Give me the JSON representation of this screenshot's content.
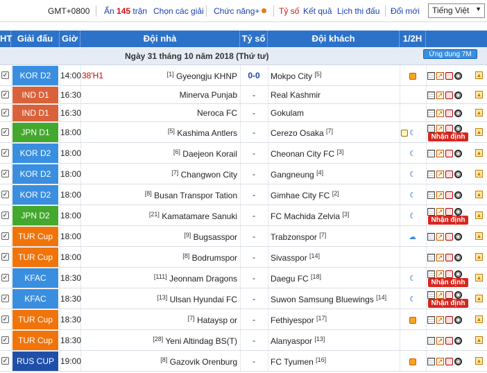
{
  "topbar": {
    "timezone": "GMT+0800",
    "hide_prefix": "Ẩn",
    "hide_count": "145",
    "hide_suffix": "trận",
    "choose_league": "Chọn các giải",
    "functions": "Chức năng+",
    "score": "Tỷ số",
    "results": "Kết quả",
    "schedule": "Lịch thi đấu",
    "refresh": "Đổi mới",
    "language": "Tiếng Việt"
  },
  "header": {
    "ht": "HT",
    "league": "Giải đấu",
    "time": "Giờ",
    "home": "Đội nhà",
    "score": "Tỷ số",
    "away": "Đội khách",
    "half": "1/2H"
  },
  "date_label": "Ngày 31 tháng 10 năm 2018 (Thứ tư)",
  "app_button": "Ứng dụng 7M",
  "analysis_label": "Nhận định",
  "colors": {
    "kor": "#3a8ee0",
    "ind": "#d9623a",
    "jpn": "#43a82e",
    "tur": "#f0740a",
    "kfac": "#3a8ee0",
    "rus": "#1f4fa8"
  },
  "matches": [
    {
      "league": "KOR D2",
      "color": "kor",
      "time": "14:00",
      "minute": "38'H1",
      "home_rank": "[1]",
      "home": "Gyeongju KHNP",
      "score": "0-0",
      "away": "Mokpo City",
      "away_rank": "[5]",
      "half": "ball",
      "analysis": false
    },
    {
      "league": "IND D1",
      "color": "ind",
      "time": "16:30",
      "minute": "",
      "home_rank": "",
      "home": "Minerva Punjab",
      "score": "-",
      "away": "Real Kashmir",
      "away_rank": "",
      "half": "",
      "analysis": false
    },
    {
      "league": "IND D1",
      "color": "ind",
      "time": "16:30",
      "minute": "",
      "home_rank": "",
      "home": "Neroca FC",
      "score": "-",
      "away": "Gokulam",
      "away_rank": "",
      "half": "",
      "analysis": false
    },
    {
      "league": "JPN D1",
      "color": "jpn",
      "time": "18:00",
      "minute": "",
      "home_rank": "[5]",
      "home": "Kashima Antlers",
      "score": "-",
      "away": "Cerezo Osaka",
      "away_rank": "[7]",
      "half": "tv-moon",
      "analysis": true
    },
    {
      "league": "KOR D2",
      "color": "kor",
      "time": "18:00",
      "minute": "",
      "home_rank": "[6]",
      "home": "Daejeon Korail",
      "score": "-",
      "away": "Cheonan City FC",
      "away_rank": "[3]",
      "half": "moon",
      "analysis": false
    },
    {
      "league": "KOR D2",
      "color": "kor",
      "time": "18:00",
      "minute": "",
      "home_rank": "[7]",
      "home": "Changwon City",
      "score": "-",
      "away": "Gangneung",
      "away_rank": "[4]",
      "half": "moon",
      "analysis": false
    },
    {
      "league": "KOR D2",
      "color": "kor",
      "time": "18:00",
      "minute": "",
      "home_rank": "[8]",
      "home": "Busan Transpor Tation",
      "score": "-",
      "away": "Gimhae City FC",
      "away_rank": "[2]",
      "half": "moon",
      "analysis": false
    },
    {
      "league": "JPN D2",
      "color": "jpn",
      "time": "18:00",
      "minute": "",
      "home_rank": "[21]",
      "home": "Kamatamare Sanuki",
      "score": "-",
      "away": "FC Machida Zelvia",
      "away_rank": "[3]",
      "half": "moon",
      "analysis": true
    },
    {
      "league": "TUR Cup",
      "color": "tur",
      "time": "18:00",
      "minute": "",
      "home_rank": "[9]",
      "home": "Bugsasspor",
      "score": "-",
      "away": "Trabzonspor",
      "away_rank": "[7]",
      "half": "sun",
      "analysis": false
    },
    {
      "league": "TUR Cup",
      "color": "tur",
      "time": "18:00",
      "minute": "",
      "home_rank": "[8]",
      "home": "Bodrumspor",
      "score": "-",
      "away": "Sivasspor",
      "away_rank": "[14]",
      "half": "",
      "analysis": false
    },
    {
      "league": "KFAC",
      "color": "kfac",
      "time": "18:30",
      "minute": "",
      "home_rank": "[111]",
      "home": "Jeonnam Dragons",
      "score": "-",
      "away": "Daegu FC",
      "away_rank": "[18]",
      "half": "moon",
      "analysis": true
    },
    {
      "league": "KFAC",
      "color": "kfac",
      "time": "18:30",
      "minute": "",
      "home_rank": "[13]",
      "home": "Ulsan Hyundai FC",
      "score": "-",
      "away": "Suwon Samsung Bluewings",
      "away_rank": "[14]",
      "half": "moon",
      "analysis": true
    },
    {
      "league": "TUR Cup",
      "color": "tur",
      "time": "18:30",
      "minute": "",
      "home_rank": "[7]",
      "home": "Hataysp or",
      "score": "-",
      "away": "Fethiyespor",
      "away_rank": "[17]",
      "half": "ball",
      "analysis": false
    },
    {
      "league": "TUR Cup",
      "color": "tur",
      "time": "18:30",
      "minute": "",
      "home_rank": "[28]",
      "home": "Yeni Altindag BS(T)",
      "score": "-",
      "away": "Alanyaspor",
      "away_rank": "[13]",
      "half": "",
      "analysis": false
    },
    {
      "league": "RUS CUP",
      "color": "rus",
      "time": "19:00",
      "minute": "",
      "home_rank": "[8]",
      "home": "Gazovik Orenburg",
      "score": "-",
      "away": "FC Tyumen",
      "away_rank": "[16]",
      "half": "ball",
      "analysis": false
    }
  ]
}
